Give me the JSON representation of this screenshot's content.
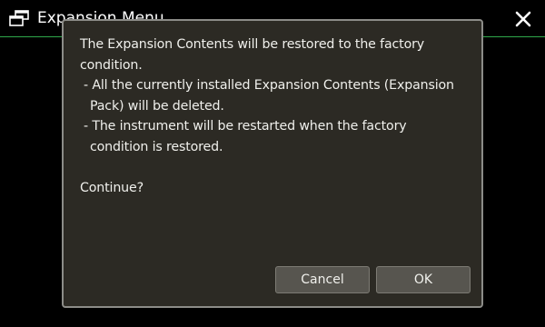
{
  "title_bar": {
    "icon": "expansion-pack-icon",
    "title": "Expansion Menu",
    "close_icon": "close-icon"
  },
  "dialog": {
    "message_lines": [
      "The Expansion Contents will be restored to the factory",
      "condition.",
      "- All the currently installed Expansion Contents (Expansion",
      "Pack) will be deleted.",
      "- The instrument will be restarted when the factory",
      "condition is restored.",
      "",
      "Continue?"
    ],
    "cancel_label": "Cancel",
    "ok_label": "OK"
  },
  "colors": {
    "background": "#000000",
    "dialog_background": "#2c2a24",
    "dialog_border": "#8c8c88",
    "button_background": "#57554f",
    "title_underline": "#2fa84a",
    "text": "#f0f0ec"
  }
}
